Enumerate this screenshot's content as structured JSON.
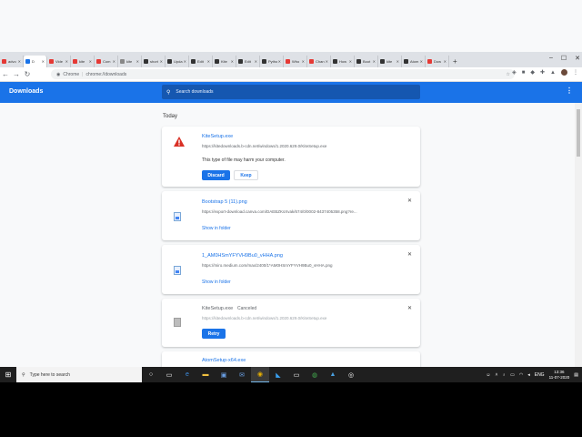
{
  "browser": {
    "tabs": [
      {
        "label": "advo",
        "color": "#e53935"
      },
      {
        "label": "D",
        "color": "#1a73e8",
        "active": true
      },
      {
        "label": "Vide",
        "color": "#e53935"
      },
      {
        "label": "kite",
        "color": "#e53935"
      },
      {
        "label": "Com",
        "color": "#e53935"
      },
      {
        "label": "kite",
        "color": "#888888"
      },
      {
        "label": "short",
        "color": "#333333"
      },
      {
        "label": "Upda",
        "color": "#333333"
      },
      {
        "label": "Edit",
        "color": "#333333"
      },
      {
        "label": "Kite",
        "color": "#333333"
      },
      {
        "label": "Edit",
        "color": "#333333"
      },
      {
        "label": "Pytho",
        "color": "#333333"
      },
      {
        "label": "Who",
        "color": "#e53935"
      },
      {
        "label": "Chan",
        "color": "#e53935"
      },
      {
        "label": "How",
        "color": "#333333"
      },
      {
        "label": "Boot",
        "color": "#333333"
      },
      {
        "label": "kite",
        "color": "#333333"
      },
      {
        "label": "Atom",
        "color": "#333333"
      },
      {
        "label": "Dow",
        "color": "#e53935"
      }
    ],
    "new_tab": "+",
    "window_controls": {
      "minimize": "–",
      "maximize": "☐",
      "close": "✕"
    },
    "omnibox": {
      "site": "Chrome",
      "url": "chrome://downloads"
    }
  },
  "downloads": {
    "title": "Downloads",
    "search_placeholder": "Search downloads",
    "section_today": "Today",
    "items": [
      {
        "name": "KiteSetup.exe",
        "url": "https://kitedownloads.b-cdn.net/windows/1.2020.629.0/KiteSetup.exe",
        "warning": "This type of file may harm your computer.",
        "discard": "Discard",
        "keep": "Keep"
      },
      {
        "name": "Bootstrap 5 (11).png",
        "url": "https://export-download.canva.com/DAEBZKsXvak/674/0/0002-8437405358.png?re...",
        "show_in_folder": "Show in folder"
      },
      {
        "name": "1_AM0HSmYFYVH9Bu0_vHHA.png",
        "url": "https://miro.medium.com/max/2400/1*AM0HSmYFYVH9Bu0_vHHA.png",
        "show_in_folder": "Show in folder"
      },
      {
        "name": "KiteSetup.exe",
        "status": "Canceled",
        "url": "https://kitedownloads.b-cdn.net/windows/1.2020.629.0/KiteSetup.exe",
        "retry": "Retry"
      },
      {
        "name": "AtomSetup-x64.exe"
      }
    ]
  },
  "taskbar": {
    "search_placeholder": "Type here to search",
    "language": "ENG",
    "time": "13:36",
    "date": "11-07-2020"
  }
}
